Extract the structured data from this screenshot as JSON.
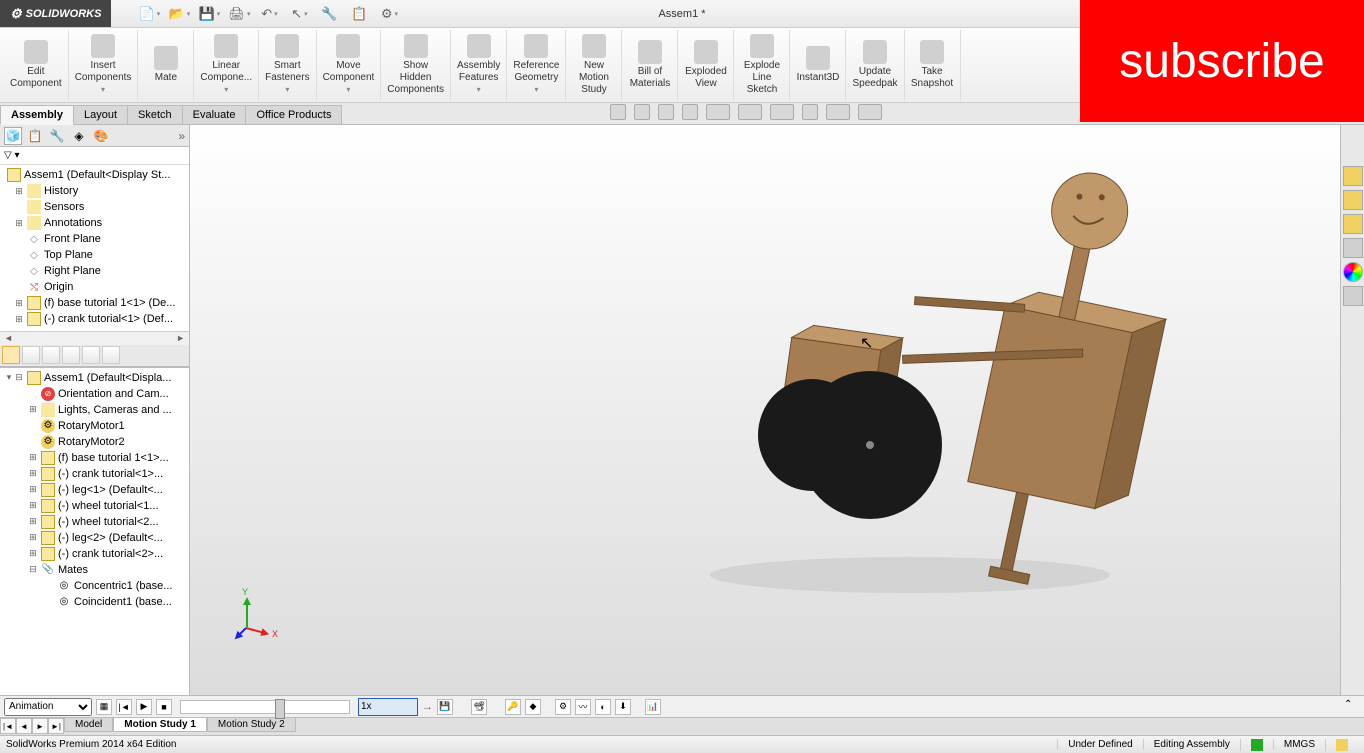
{
  "title": "Assem1 *",
  "logo": "SOLIDWORKS",
  "subscribe": "subscribe",
  "ribbon": [
    {
      "label": "Edit\nComponent",
      "dd": false
    },
    {
      "label": "Insert\nComponents",
      "dd": true
    },
    {
      "label": "Mate",
      "dd": false
    },
    {
      "label": "Linear\nCompone...",
      "dd": true
    },
    {
      "label": "Smart\nFasteners",
      "dd": true
    },
    {
      "label": "Move\nComponent",
      "dd": true
    },
    {
      "label": "Show\nHidden\nComponents",
      "dd": false
    },
    {
      "label": "Assembly\nFeatures",
      "dd": true
    },
    {
      "label": "Reference\nGeometry",
      "dd": true
    },
    {
      "label": "New\nMotion\nStudy",
      "dd": false
    },
    {
      "label": "Bill of\nMaterials",
      "dd": false
    },
    {
      "label": "Exploded\nView",
      "dd": false
    },
    {
      "label": "Explode\nLine\nSketch",
      "dd": false
    },
    {
      "label": "Instant3D",
      "dd": false
    },
    {
      "label": "Update\nSpeedpak",
      "dd": false
    },
    {
      "label": "Take\nSnapshot",
      "dd": false
    }
  ],
  "tabs": [
    "Assembly",
    "Layout",
    "Sketch",
    "Evaluate",
    "Office Products"
  ],
  "active_tab": 0,
  "feature_tree": {
    "root": "Assem1  (Default<Display St...",
    "items": [
      {
        "icon": "folder",
        "label": "History",
        "exp": "+"
      },
      {
        "icon": "folder",
        "label": "Sensors",
        "exp": ""
      },
      {
        "icon": "folder",
        "label": "Annotations",
        "exp": "+"
      },
      {
        "icon": "plane",
        "label": "Front Plane",
        "exp": ""
      },
      {
        "icon": "plane",
        "label": "Top Plane",
        "exp": ""
      },
      {
        "icon": "plane",
        "label": "Right Plane",
        "exp": ""
      },
      {
        "icon": "origin",
        "label": "Origin",
        "exp": ""
      },
      {
        "icon": "part",
        "label": "(f) base tutorial 1<1> (De...",
        "exp": "+"
      },
      {
        "icon": "part",
        "label": "(-) crank tutorial<1> (Def...",
        "exp": "+"
      }
    ]
  },
  "motion_tree": {
    "root": "Assem1  (Default<Displa...",
    "items": [
      {
        "icon": "err",
        "label": "Orientation and Cam...",
        "exp": ""
      },
      {
        "icon": "folder",
        "label": "Lights, Cameras and ...",
        "exp": "+"
      },
      {
        "icon": "motor",
        "label": "RotaryMotor1",
        "exp": ""
      },
      {
        "icon": "motor",
        "label": "RotaryMotor2",
        "exp": ""
      },
      {
        "icon": "part",
        "label": "(f) base tutorial 1<1>...",
        "exp": "+"
      },
      {
        "icon": "part",
        "label": "(-) crank tutorial<1>...",
        "exp": "+"
      },
      {
        "icon": "part",
        "label": "(-) leg<1> (Default<...",
        "exp": "+"
      },
      {
        "icon": "part",
        "label": "(-) wheel tutorial<1...",
        "exp": "+"
      },
      {
        "icon": "part",
        "label": "(-) wheel tutorial<2...",
        "exp": "+"
      },
      {
        "icon": "part",
        "label": "(-) leg<2> (Default<...",
        "exp": "+"
      },
      {
        "icon": "part",
        "label": "(-) crank tutorial<2>...",
        "exp": "+"
      },
      {
        "icon": "mates",
        "label": "Mates",
        "exp": "-"
      },
      {
        "icon": "mate",
        "label": "Concentric1 (base...",
        "exp": "",
        "indent": 1
      },
      {
        "icon": "mate",
        "label": "Coincident1 (base...",
        "exp": "",
        "indent": 1
      }
    ]
  },
  "timeline": {
    "mode": "Animation",
    "speed": "1x"
  },
  "bottom_tabs": [
    "Model",
    "Motion Study 1",
    "Motion Study 2"
  ],
  "active_bottom_tab": 1,
  "status": {
    "left": "SolidWorks Premium 2014 x64 Edition",
    "defined": "Under Defined",
    "editing": "Editing Assembly",
    "units": "MMGS"
  }
}
